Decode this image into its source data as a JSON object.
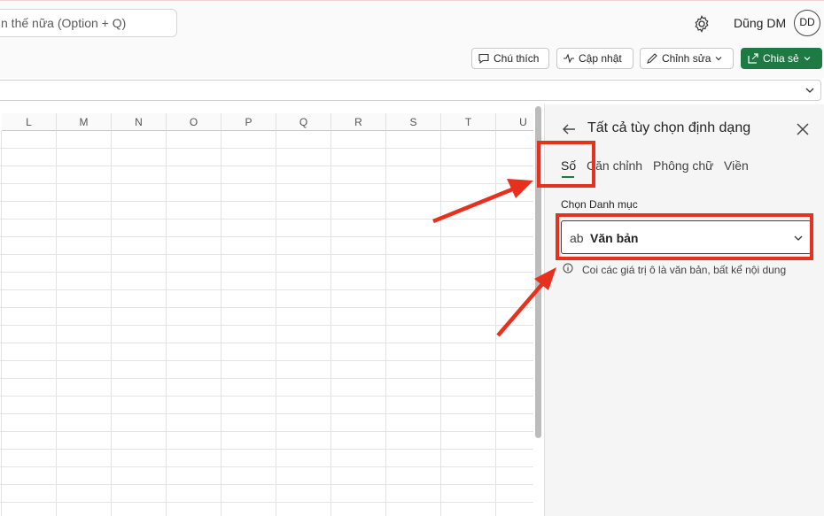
{
  "header": {
    "search_text": "n thế nữa (Option + Q)",
    "username": "Dũng DM",
    "avatar_initials": "DD"
  },
  "toolbar": {
    "comment_label": "Chú thích",
    "update_label": "Cập nhật",
    "edit_label": "Chỉnh sửa",
    "share_label": "Chia sẻ"
  },
  "grid": {
    "columns": [
      "L",
      "M",
      "N",
      "O",
      "P",
      "Q",
      "R",
      "S",
      "T",
      "U"
    ]
  },
  "format_pane": {
    "title": "Tất cả tùy chọn định dạng",
    "tabs": [
      "Số",
      "Căn chỉnh",
      "Phông chữ",
      "Viền"
    ],
    "active_tab": "Số",
    "category_label": "Chọn Danh mục",
    "category_icon_text": "ab",
    "category_value": "Văn bản",
    "info_text": "Coi các giá trị ô là văn bản, bất kể nội dung"
  },
  "colors": {
    "accent_green": "#1d7a43",
    "highlight_red": "#e8301f"
  }
}
